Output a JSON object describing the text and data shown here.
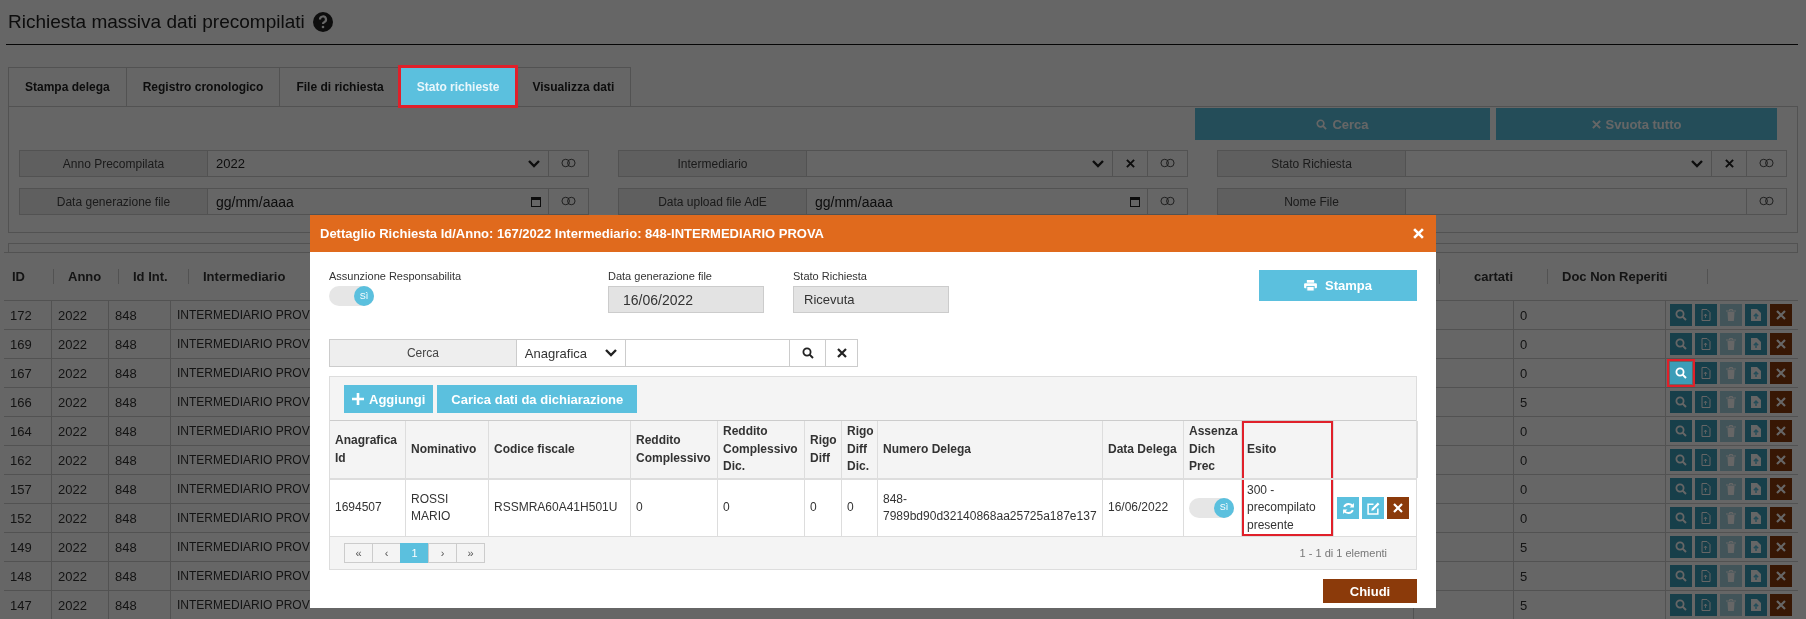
{
  "page": {
    "title": "Richiesta massiva dati precompilati"
  },
  "tabs": [
    {
      "label": "Stampa delega",
      "selected": false,
      "highlighted": false
    },
    {
      "label": "Registro cronologico",
      "selected": false,
      "highlighted": false
    },
    {
      "label": "File di richiesta",
      "selected": false,
      "highlighted": false
    },
    {
      "label": "Stato richieste",
      "selected": true,
      "highlighted": true
    },
    {
      "label": "Visualizza dati",
      "selected": false,
      "highlighted": false
    }
  ],
  "actions": [
    {
      "kind": "search",
      "label": "Cerca"
    },
    {
      "kind": "clear",
      "label": "Svuota tutto"
    }
  ],
  "filters": [
    [
      {
        "label": "Anno Precompilata",
        "kind": "select",
        "value": "2022",
        "clearable": false
      },
      {
        "label": "Intermediario",
        "kind": "select",
        "clearable": true
      },
      {
        "label": "Stato Richiesta",
        "kind": "select",
        "clearable": true
      }
    ],
    [
      {
        "label": "Data generazione file",
        "kind": "date",
        "placeholder": "gg/mm/aaaa",
        "clearable": false
      },
      {
        "label": "Data upload file AdE",
        "kind": "date",
        "placeholder": "gg/mm/aaaa",
        "clearable": false
      },
      {
        "label": "Nome File",
        "kind": "text",
        "clearable": false
      }
    ]
  ],
  "table": {
    "columns": [
      "ID",
      "Anno",
      "Id Int.",
      "Intermediario",
      "cartati",
      "Doc Non Reperiti"
    ],
    "rows": [
      {
        "id": "172",
        "anno": "2022",
        "id_int": "848",
        "intermediario": "INTERMEDIARIO PROV",
        "doc_non_reperiti": "0",
        "delete_disabled": true,
        "highlighted": false
      },
      {
        "id": "169",
        "anno": "2022",
        "id_int": "848",
        "intermediario": "INTERMEDIARIO PROV",
        "doc_non_reperiti": "0",
        "delete_disabled": true,
        "highlighted": false
      },
      {
        "id": "167",
        "anno": "2022",
        "id_int": "848",
        "intermediario": "INTERMEDIARIO PROV",
        "doc_non_reperiti": "0",
        "delete_disabled": true,
        "highlighted": true
      },
      {
        "id": "166",
        "anno": "2022",
        "id_int": "848",
        "intermediario": "INTERMEDIARIO PROV",
        "doc_non_reperiti": "5",
        "delete_disabled": true,
        "highlighted": false
      },
      {
        "id": "164",
        "anno": "2022",
        "id_int": "848",
        "intermediario": "INTERMEDIARIO PROV",
        "doc_non_reperiti": "0",
        "delete_disabled": true,
        "highlighted": false
      },
      {
        "id": "162",
        "anno": "2022",
        "id_int": "848",
        "intermediario": "INTERMEDIARIO PROV",
        "doc_non_reperiti": "0",
        "delete_disabled": true,
        "highlighted": false
      },
      {
        "id": "157",
        "anno": "2022",
        "id_int": "848",
        "intermediario": "INTERMEDIARIO PROV",
        "doc_non_reperiti": "0",
        "delete_disabled": true,
        "highlighted": false
      },
      {
        "id": "152",
        "anno": "2022",
        "id_int": "848",
        "intermediario": "INTERMEDIARIO PROV",
        "doc_non_reperiti": "0",
        "delete_disabled": true,
        "highlighted": false
      },
      {
        "id": "149",
        "anno": "2022",
        "id_int": "848",
        "intermediario": "INTERMEDIARIO PROV",
        "doc_non_reperiti": "5",
        "delete_disabled": true,
        "highlighted": false
      },
      {
        "id": "148",
        "anno": "2022",
        "id_int": "848",
        "intermediario": "INTERMEDIARIO PROV",
        "doc_non_reperiti": "5",
        "delete_disabled": true,
        "highlighted": false
      },
      {
        "id": "147",
        "anno": "2022",
        "id_int": "848",
        "intermediario": "INTERMEDIARIO PROV",
        "doc_non_reperiti": "5",
        "delete_disabled": true,
        "highlighted": false
      }
    ]
  },
  "modal": {
    "title": "Dettaglio Richiesta Id/Anno: 167/2022 Intermediario: 848-INTERMEDIARIO PROVA",
    "responsibility": {
      "label": "Assunzione Responsabilita",
      "on": true,
      "text": "Sì"
    },
    "fields": [
      {
        "label": "Data generazione file",
        "value": "16/06/2022"
      },
      {
        "label": "Stato Richiesta",
        "value": "Ricevuta"
      }
    ],
    "print_button": "Stampa",
    "search": {
      "label": "Cerca",
      "field": "Anagrafica"
    },
    "toolbar": [
      {
        "kind": "add",
        "label": "Aggiungi"
      },
      {
        "kind": "load",
        "label": "Carica dati da dichiarazione"
      }
    ],
    "columns": [
      {
        "label": "Anagrafica Id",
        "highlighted": false
      },
      {
        "label": "Nominativo",
        "highlighted": false
      },
      {
        "label": "Codice fiscale",
        "highlighted": false
      },
      {
        "label": "Reddito Complessivo",
        "highlighted": false
      },
      {
        "label": "Reddito Complessivo Dic.",
        "highlighted": false
      },
      {
        "label": "Rigo Diff",
        "highlighted": false
      },
      {
        "label": "Rigo Diff Dic.",
        "highlighted": false
      },
      {
        "label": "Numero Delega",
        "highlighted": false
      },
      {
        "label": "Data Delega",
        "highlighted": false
      },
      {
        "label": "Assenza Dich Prec",
        "highlighted": false
      },
      {
        "label": "Esito",
        "highlighted": true
      }
    ],
    "rows": [
      {
        "cells": [
          {
            "kind": "text",
            "text": "1694507"
          },
          {
            "kind": "text",
            "text": "ROSSI MARIO"
          },
          {
            "kind": "text",
            "text": "RSSMRA60A41H501U"
          },
          {
            "kind": "text",
            "text": "0"
          },
          {
            "kind": "text",
            "text": "0"
          },
          {
            "kind": "text",
            "text": "0"
          },
          {
            "kind": "text",
            "text": "0"
          },
          {
            "kind": "text",
            "text": "848-7989bd90d32140868aa25725a187e137"
          },
          {
            "kind": "text",
            "text": "16/06/2022"
          },
          {
            "kind": "toggle",
            "on": true,
            "text": "Sì"
          },
          {
            "kind": "text",
            "text": "300 - precompilato presente"
          }
        ]
      }
    ],
    "pages": [
      {
        "label": "«",
        "selected": false
      },
      {
        "label": "‹",
        "selected": false
      },
      {
        "label": "1",
        "selected": true
      },
      {
        "label": "›",
        "selected": false
      },
      {
        "label": "»",
        "selected": false
      }
    ],
    "summary": "1 - 1 di 1 elementi",
    "close_button": "Chiudi"
  }
}
